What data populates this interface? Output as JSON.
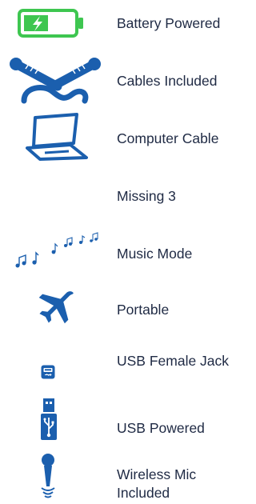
{
  "features": {
    "items": [
      {
        "label": "Battery Powered",
        "icon": "battery-charging-icon"
      },
      {
        "label": "Cables Included",
        "icon": "cables-icon"
      },
      {
        "label": "Computer Cable",
        "icon": "laptop-icon"
      },
      {
        "label": "Missing 3",
        "icon": ""
      },
      {
        "label": "Music Mode",
        "icon": "music-notes-icon"
      },
      {
        "label": "Portable",
        "icon": "airplane-icon"
      },
      {
        "label": "USB Female Jack",
        "icon": "usb-port-icon"
      },
      {
        "label": "USB Powered",
        "icon": "usb-icon"
      },
      {
        "label": "Wireless Mic Included",
        "icon": "wireless-mic-icon"
      }
    ]
  },
  "colors": {
    "battery_green": "#3ec650",
    "icon_blue": "#1b5fae",
    "text": "#1f2a44"
  }
}
